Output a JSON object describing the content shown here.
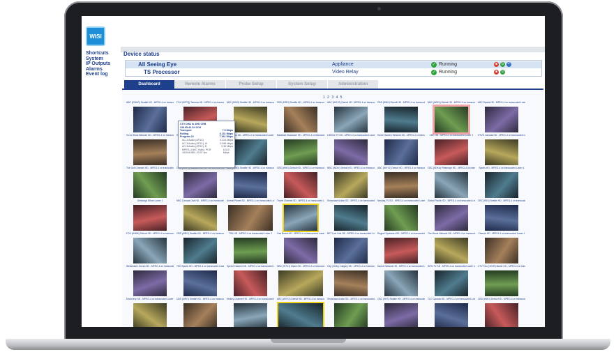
{
  "brand": {
    "logo_text": "WISI"
  },
  "sidebar": {
    "items": [
      "Shortcuts",
      "System",
      "IP Outputs",
      "Alarms",
      "Event log"
    ]
  },
  "page_title": "Device status",
  "devices": [
    {
      "name": "All Seeing Eye",
      "type": "Appliance",
      "status": "Running"
    },
    {
      "name": "TS Processor",
      "type": "Video Relay",
      "status": "Running"
    }
  ],
  "tabs": [
    "Dashboard",
    "Remote Alarms",
    "Probe Setup",
    "System Setup",
    "Administration"
  ],
  "active_tab": "Dashboard",
  "pager": "1 2 3 4 5",
  "colors": {
    "brand_blue": "#1d3f8c",
    "selected_outline": "#f1d21a",
    "alert_outline": "#f4a6ad",
    "running_green": "#2ea43a"
  },
  "tooltip": {
    "title": "CTV DHD to 4HD CRB",
    "address": "239.95.46.22:1234",
    "transport_label": "Transport",
    "transport_value": "7.5 Mbps",
    "rate_label": "Rolling",
    "rate_value": "8.131 Mbps",
    "program_label": "Program 22",
    "program_value": "7.361 Mbps",
    "streams": [
      {
        "label": "AC-3 Audio (ATSC)",
        "value": "0.224 Mbps"
      },
      {
        "label": "AC-3 Audio (ATSC), VI",
        "value": "0.096 Mbps"
      },
      {
        "label": "AC-3 Audio (ATSC), E.",
        "value": "0.36 Mbps"
      },
      {
        "label": "MPEG-4 AVC Video, PCR 1920x1080i, 29.97 fps",
        "value": "6.310 Mbps"
      }
    ]
  },
  "thumbnails": [
    {
      "label": "ABC (KOMO) Seattle HD - MPEG-4 on transcoded Lower 1"
    },
    {
      "label": "FOX (KCPQ) Tacoma HD - MPEG-4 on transcoded Lower 1"
    },
    {
      "label": "NBC (KING) Seattle HD - MPEG-4 on transcoded Lower 1"
    },
    {
      "label": "CBS (KIRO) Seattle HD - MPEG-4 on transcoded Lower 1"
    },
    {
      "label": "ABC (WXYZ) Detroit HD - MPEG-4 on transcoded Lower 1"
    },
    {
      "label": "CBS (WWJ) Detroit HD - MPEG-4 on transcoded Lower 1"
    },
    {
      "label": "NBC (WDIV) Detroit HD - MPEG-4 on transcoded Lower 1"
    },
    {
      "label": "ABC Sports HD - MPEG-4 on transcoded Lower 1"
    },
    {
      "label": "Go to Show Network SD - MPEG-4 on transcoded Lower 1"
    },
    {
      "label": "Sportsnet News Network SD - MPEG-4 on transcoded Lower 1"
    },
    {
      "label": "Sky News SD - MPEG-4 on transcoded Lower 1"
    },
    {
      "label": "Baseball Showcase HD - MPEG-4 on transcoded Lower 1"
    },
    {
      "label": "Lifetime TV HD - MPEG-4 on transcoded Lower 1"
    },
    {
      "label": "Home Garden Network HD - MPEG-4 on transcoded Lower 1"
    },
    {
      "label": "CBC HD - MPEG-4 on transcoded Lower 1"
    },
    {
      "label": "HTVG Canada HD - MPEG-4 on transcoded Lower 1"
    },
    {
      "label": "The Golf Channel HD - MPEG-4 on transcoded Lower 1"
    },
    {
      "label": "CBC (KUTV) Sacramento HD - MPEG-4 on transcoded Lower 1"
    },
    {
      "label": "NBC (KING) Seattle HD - MPEG-4 on transcoded Lower 1"
    },
    {
      "label": "CBS (WWJ) Detroit HD - MPEG-4 on transcoded Lower 1"
    },
    {
      "label": "NBC (WDIV) Detroit HD - MPEG-4 on transcoded Lower 1"
    },
    {
      "label": "ABC (WXYZ) Detroit HD - MPEG-4 on transcoded Lower 1"
    },
    {
      "label": "CBC (KDKA) Pittsburgh HD - MPEG-4 on transcoded Lower 1"
    },
    {
      "label": "Sports HD - MPEG-4 on transcoded Lower 1"
    },
    {
      "label": "Getaways Ethan Lower 1"
    },
    {
      "label": "NBC Canada Oak HD - MPEG-4 on transcoded Lower 1"
    },
    {
      "label": "Animal Planet SD - MPEG-4 on transcoded Lower 1"
    },
    {
      "label": "Travel Channel SD - MPEG-4 on transcoded Lower 1"
    },
    {
      "label": "Showcase Action SD - MPEG-4 on transcoded Lower 1"
    },
    {
      "label": "Nasdaq TV SD - MPEG-4 on transcoded Lower 1"
    },
    {
      "label": "Global Pacific SD - MPEG-4 on transcoded Lower 1"
    },
    {
      "label": "CBC (KKS) Seattle HD - MPEG-4 on transcoded Lower 1"
    },
    {
      "label": "FOX (WJBK) Detroit HD - MPEG-4 on transcoded Lower 1"
    },
    {
      "label": "CBS (KIRO) Seattle HD - MPEG-4 on transcoded Lower 1"
    },
    {
      "label": "TSN HD - MPEG-4 on transcoded Lower 1"
    },
    {
      "label": "Gas Board HD - MPEG-4 on transcoded Lower 1"
    },
    {
      "label": "BET Live Link HD - MPEG-4 on transcoded Lower 1"
    },
    {
      "label": "Rogers Sportsnet HD - MPEG-4 on transcoded Lower 1"
    },
    {
      "label": "The Movie Network HD - MPEG-4 on transcoded Lower 1"
    },
    {
      "label": "Cinema HD - MPEG-4 on transcoded Lower 1"
    },
    {
      "label": "Westerdam Ocean SD - MPEG-4 on transcoded Lower 1"
    },
    {
      "label": "TSN Sports HD - MPEG-4 on transcoded Lower 1"
    },
    {
      "label": "Speed Channel SD - MPEG-4 on transcoded Lower 1"
    },
    {
      "label": "NBC (WTVJ) Miami HD - MPEG-4 on transcoded Lower 1"
    },
    {
      "label": "City (CKAL) Calgary HD - MPEG-4 on transcoded Lower 1"
    },
    {
      "label": "Dance Network HD - MPEG-4 on transcoded Lower 1"
    },
    {
      "label": "WTN TV SD - MPEG-4 on transcoded Lower 1"
    },
    {
      "label": "CTV Two (CKVR) Barrie HD - MPEG-4 on transcoded Lower 1"
    },
    {
      "label": "Discovery HD - MPEG-4 on transcoded Lower 1"
    },
    {
      "label": "CBS (KIRO) Seattle HD - MPEG-4 on transcoded Lower 1"
    },
    {
      "label": "History Channel HD - MPEG-4 on transcoded Lower 1"
    },
    {
      "label": "ABC (WXYZ) Detroit HD - MPEG-4 on transcoded Lower 1"
    },
    {
      "label": "Showcase Action SD - MPEG-4 on transcoded Lower 1"
    },
    {
      "label": "CBC (KKS) Seattle HD - MPEG-4 on transcoded Lower 1"
    },
    {
      "label": "TLC Canada HD - MPEG-4 on transcoded Lower 1"
    },
    {
      "label": "CBS (WWJ) Detroit HD - MPEG-4 on transcoded Lower 1"
    }
  ]
}
